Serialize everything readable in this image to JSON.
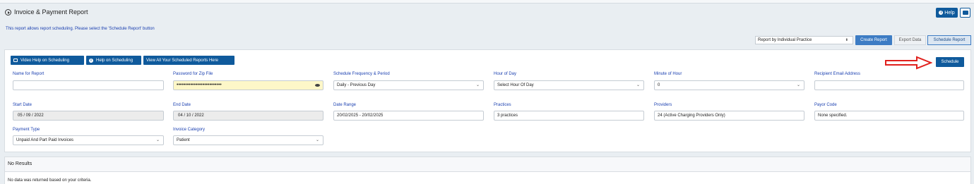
{
  "header": {
    "title": "Invoice & Payment Report",
    "help_label": "Help",
    "print_icon": "printer-icon"
  },
  "info_text": "This report allows report scheduling. Please select the 'Schedule Report' button",
  "toolbar": {
    "report_select_value": "Report by Individual Practice",
    "create_report": "Create Report",
    "export_data": "Export Data",
    "schedule_report": "Schedule Report"
  },
  "panel_buttons": {
    "video_help": "Video Help on Scheduling",
    "help_scheduling": "Help on Scheduling",
    "view_all": "View All Your Scheduled Reports Here",
    "schedule": "Schedule"
  },
  "form": {
    "name_for_report": {
      "label": "Name for Report",
      "value": ""
    },
    "password_zip": {
      "label": "Password for Zip File",
      "value": "••••••••••••••••••••••••••"
    },
    "schedule_frequency": {
      "label": "Schedule Frequency & Period",
      "value": "Daily - Previous Day"
    },
    "hour_of_day": {
      "label": "Hour of Day",
      "value": "Select Hour Of Day"
    },
    "minute_of_hour": {
      "label": "Minute of Hour",
      "value": "0"
    },
    "recipient_email": {
      "label": "Recipient Email Address",
      "value": ""
    },
    "start_date": {
      "label": "Start Date",
      "value": "05 / 09 / 2022"
    },
    "end_date": {
      "label": "End Date",
      "value": "04 / 10 / 2022"
    },
    "date_range": {
      "label": "Date Range",
      "value": "20/02/2025 - 20/02/2025"
    },
    "practices": {
      "label": "Practices",
      "value": "3 practices"
    },
    "providers": {
      "label": "Providers",
      "value": "24 (Active Charging Providers Only)"
    },
    "payor_code": {
      "label": "Payor Code",
      "value": "None specified."
    },
    "payment_type": {
      "label": "Payment Type",
      "value": "Unpaid And Part Paid Invoices"
    },
    "invoice_category": {
      "label": "Invoice Category",
      "value": "Patient"
    }
  },
  "results": {
    "title": "No Results",
    "message": "No data was returned based on your criteria."
  },
  "colors": {
    "primary": "#0f5a9c",
    "label_blue": "#1a3fb0",
    "arrow_red": "#e0201c",
    "password_bg": "#fdf7c8"
  }
}
